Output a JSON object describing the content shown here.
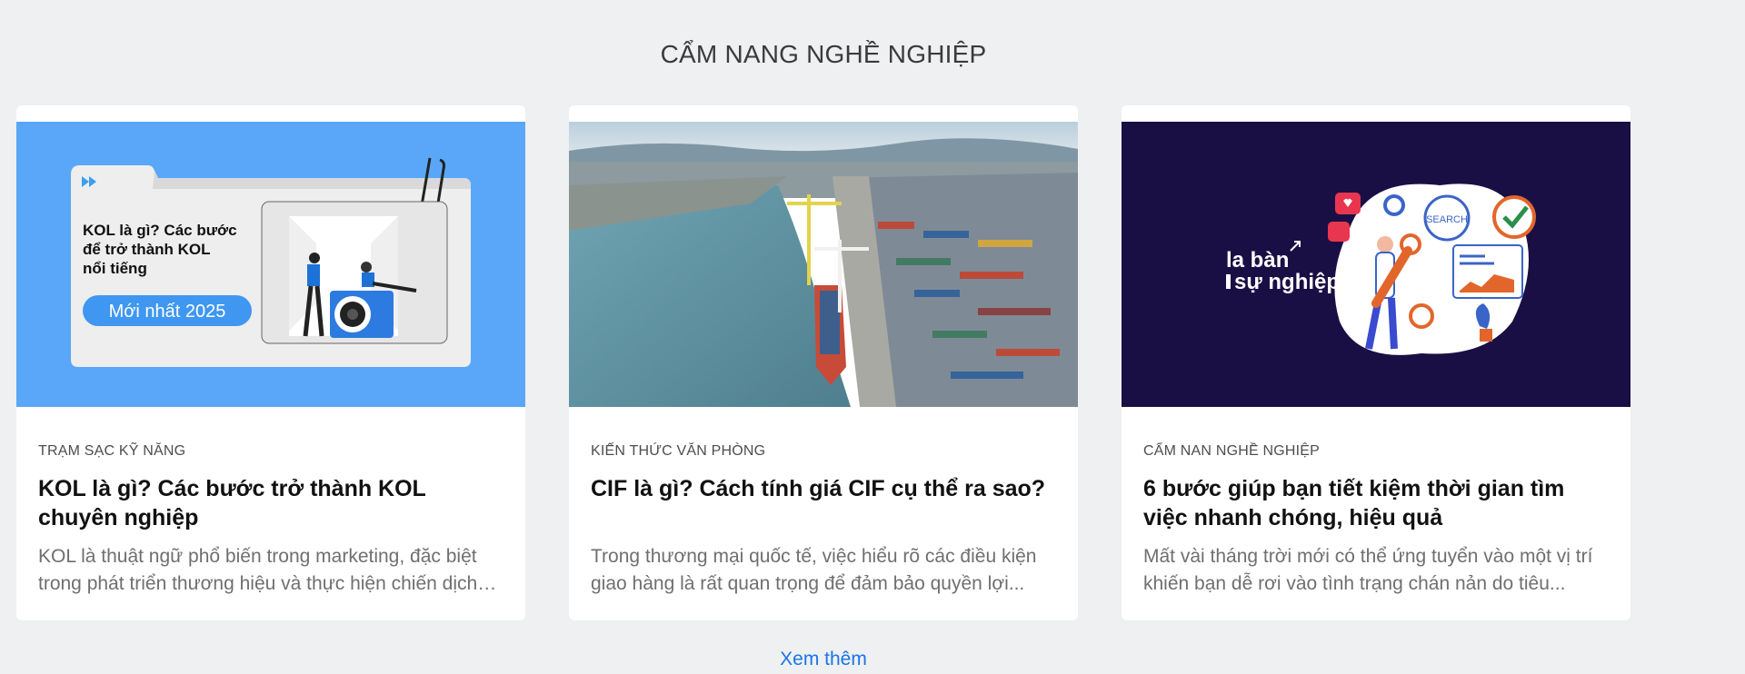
{
  "section": {
    "title": "CẨM NANG NGHỀ NGHIỆP"
  },
  "cards": [
    {
      "category": "TRẠM SẠC KỸ NĂNG",
      "title": "KOL là gì? Các bước trở thành KOL chuyên nghiệp",
      "excerpt": "KOL là thuật ngữ phổ biến trong marketing, đặc biệt trong phát triển thương hiệu và thực hiện chiến dịch quảng bá sản phẩm...",
      "thumb": {
        "line1": "KOL là gì? Các bước",
        "line2": "để trở thành KOL",
        "line3": "nổi tiếng",
        "badge": "Mới nhất 2025",
        "bg": "#5aa7f9"
      }
    },
    {
      "category": "KIẾN THỨC VĂN PHÒNG",
      "title": "CIF là gì? Cách tính giá CIF cụ thể ra sao?",
      "excerpt": "Trong thương mại quốc tế, việc hiểu rõ các điều kiện giao hàng là rất quan trọng để đảm bảo quyền lợi...",
      "thumb": {
        "bg": "#6f9fb0"
      }
    },
    {
      "category": "CẨM NAN NGHỀ NGHIỆP",
      "title": "6 bước giúp bạn tiết kiệm thời gian tìm việc nhanh chóng, hiệu quả",
      "excerpt": "Mất vài tháng trời mới có thể ứng tuyển vào một vị trí khiến bạn dễ rơi vào tình trạng chán nản do tiêu...",
      "thumb": {
        "brand_line1": "la bàn",
        "brand_line2": "sự nghiệp",
        "search_label": "SEARCH",
        "bg": "#1a0f45"
      }
    }
  ],
  "see_more": "Xem thêm"
}
